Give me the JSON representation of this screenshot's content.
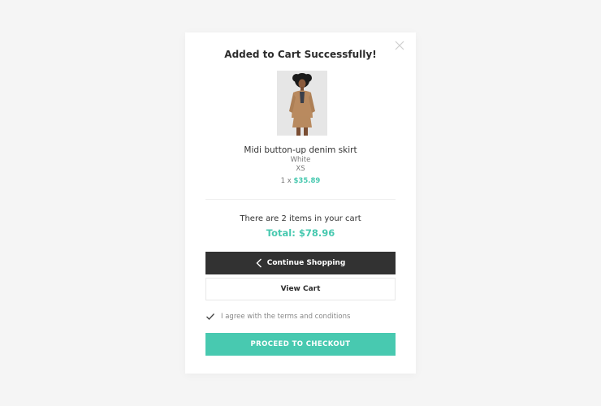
{
  "modal": {
    "title": "Added to Cart Successfully!",
    "close_icon": "close-icon"
  },
  "product": {
    "image_icon": "product-photo",
    "name": "Midi button-up denim skirt",
    "color": "White",
    "size": "XS",
    "quantity_prefix": "1 x",
    "price": "$35.89"
  },
  "cart": {
    "count_text": "There are 2 items in your cart",
    "total_text": "Total: $78.96"
  },
  "buttons": {
    "continue_label": "Continue Shopping",
    "continue_icon": "chevron-left-icon",
    "view_cart_label": "View Cart",
    "checkout_label": "PROCEED TO CHECKOUT"
  },
  "terms": {
    "label": "I agree with the terms and conditions",
    "checked": true,
    "check_icon": "checkmark-icon"
  },
  "colors": {
    "accent": "#48c9b0",
    "dark_button": "#323232",
    "background": "#f5f5f5"
  }
}
